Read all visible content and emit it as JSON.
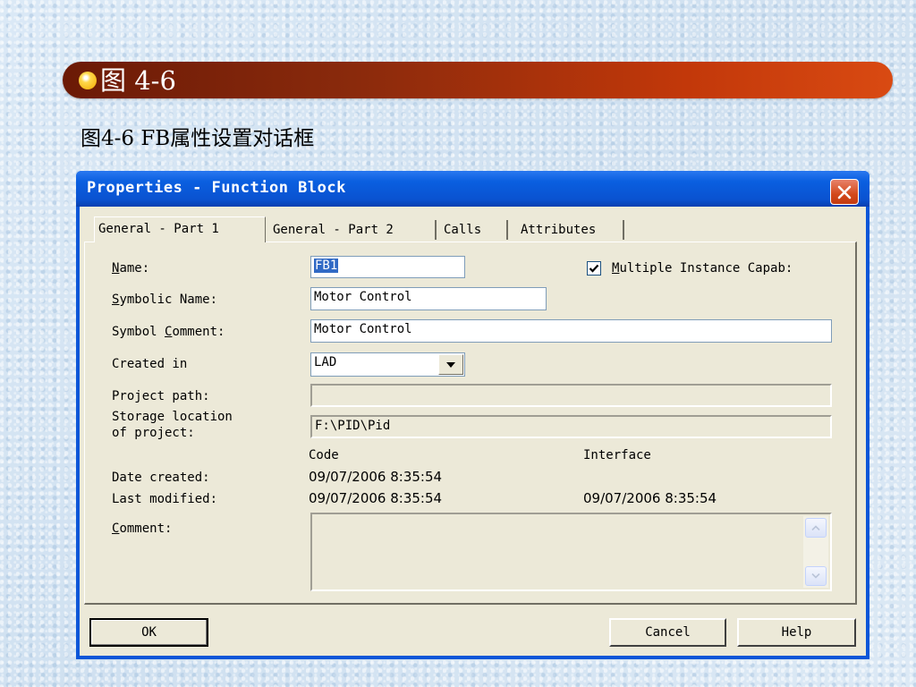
{
  "slide": {
    "heading": "图 4-6",
    "caption": "图4-6 FB属性设置对话框"
  },
  "window": {
    "title": "Properties - Function Block",
    "close_icon": "close-icon"
  },
  "tabs": [
    {
      "label": "General - Part 1",
      "active": true
    },
    {
      "label": "General - Part 2",
      "active": false
    },
    {
      "label": "Calls",
      "active": false
    },
    {
      "label": "Attributes",
      "active": false
    }
  ],
  "form": {
    "name_label_ul": "N",
    "name_label_rest": "ame:",
    "name_value": "FB1",
    "multi_instance_checked": true,
    "multi_instance_label_ul": "M",
    "multi_instance_label_rest": "ultiple Instance Capab:",
    "symbolic_label_ul": "S",
    "symbolic_label_rest": "ymbolic Name:",
    "symbolic_value": "Motor Control",
    "symbol_comment_label_pre": "Symbol ",
    "symbol_comment_label_ul": "C",
    "symbol_comment_label_rest": "omment:",
    "symbol_comment_value": "Motor Control",
    "created_in_label": "Created in",
    "created_in_value": "LAD",
    "project_path_label": "Project path:",
    "project_path_value": "",
    "storage_label_1": "Storage location",
    "storage_label_2": "of project:",
    "storage_value": "F:\\PID\\Pid",
    "code_header": "Code",
    "interface_header": "Interface",
    "date_created_label": "Date created:",
    "date_created_code": "09/07/2006  8:35:54",
    "date_created_interface": "",
    "last_modified_label": "Last modified:",
    "last_modified_code": "09/07/2006  8:35:54",
    "last_modified_interface": "09/07/2006  8:35:54",
    "comment_label_ul": "C",
    "comment_label_rest": "omment:",
    "comment_value": ""
  },
  "buttons": {
    "ok": "OK",
    "cancel": "Cancel",
    "help": "Help"
  }
}
